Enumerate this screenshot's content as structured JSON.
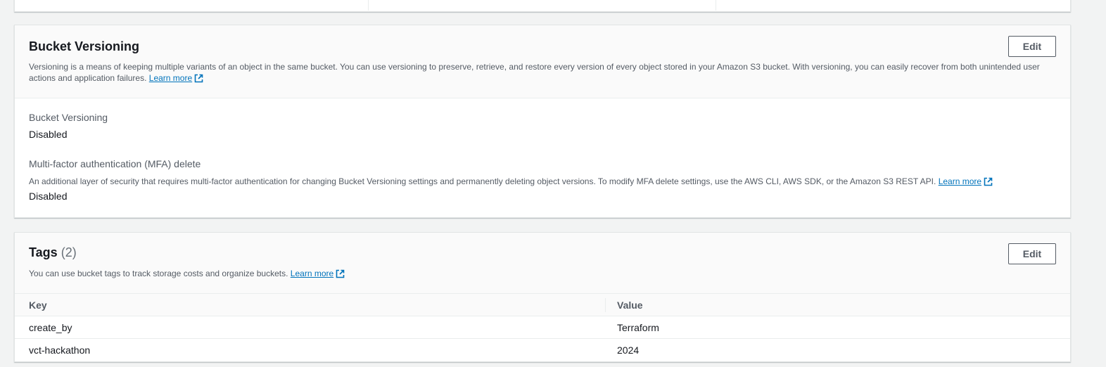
{
  "versioning": {
    "title": "Bucket Versioning",
    "edit_label": "Edit",
    "description": "Versioning is a means of keeping multiple variants of an object in the same bucket. You can use versioning to preserve, retrieve, and restore every version of every object stored in your Amazon S3 bucket. With versioning, you can easily recover from both unintended user actions and application failures.",
    "learn_more": "Learn more",
    "status_label": "Bucket Versioning",
    "status_value": "Disabled",
    "mfa_label": "Multi-factor authentication (MFA) delete",
    "mfa_description": "An additional layer of security that requires multi-factor authentication for changing Bucket Versioning settings and permanently deleting object versions. To modify MFA delete settings, use the AWS CLI, AWS SDK, or the Amazon S3 REST API.",
    "mfa_learn_more": "Learn more",
    "mfa_value": "Disabled"
  },
  "tags": {
    "title": "Tags",
    "count": "(2)",
    "edit_label": "Edit",
    "description": "You can use bucket tags to track storage costs and organize buckets.",
    "learn_more": "Learn more",
    "columns": [
      "Key",
      "Value"
    ],
    "rows": [
      {
        "key": "create_by",
        "value": "Terraform"
      },
      {
        "key": "vct-hackathon",
        "value": "2024"
      }
    ]
  },
  "colors": {
    "link": "#0073bb",
    "background": "#f2f3f3",
    "text": "#16191f",
    "secondary_text": "#545b64"
  },
  "icons": [
    "external-link-icon"
  ]
}
